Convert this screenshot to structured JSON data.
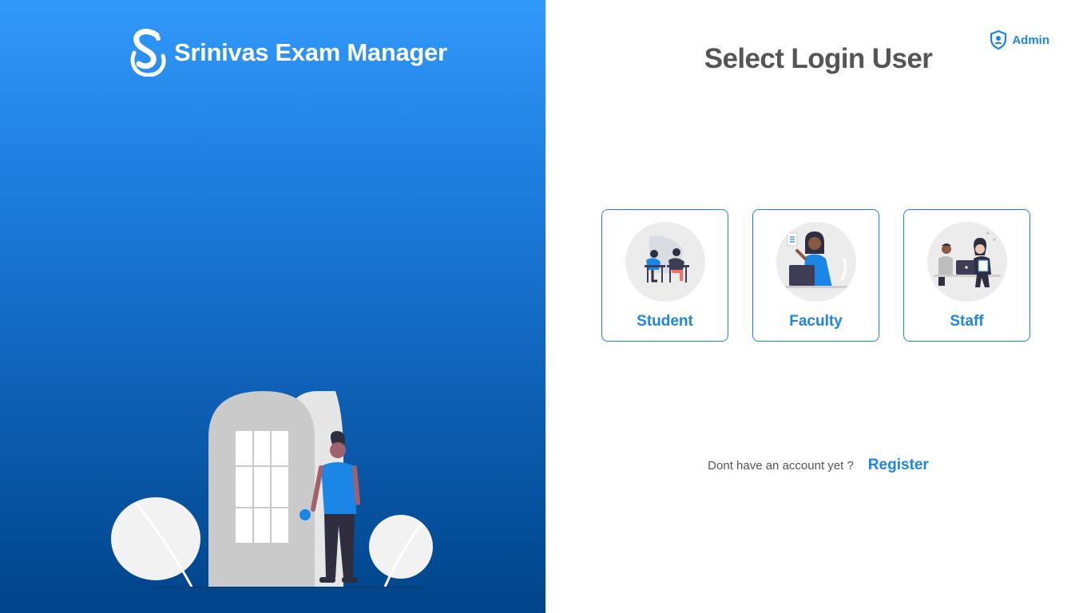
{
  "brand": {
    "name": "Srinivas Exam Manager",
    "logo_icon": "srinivas-logo-icon"
  },
  "header": {
    "admin_label": "Admin",
    "admin_icon": "shield-user-icon"
  },
  "main": {
    "title": "Select Login User",
    "user_types": [
      {
        "label": "Student",
        "icon": "students-at-desks-illustration"
      },
      {
        "label": "Faculty",
        "icon": "faculty-laptop-illustration"
      },
      {
        "label": "Staff",
        "icon": "staff-office-illustration"
      }
    ]
  },
  "footer": {
    "prompt": "Dont have an account yet ?",
    "register_label": "Register"
  },
  "colors": {
    "accent": "#1b86e5",
    "left_panel_top": "#3199fb",
    "left_panel_bottom": "#00448a",
    "title_text": "#555555"
  }
}
